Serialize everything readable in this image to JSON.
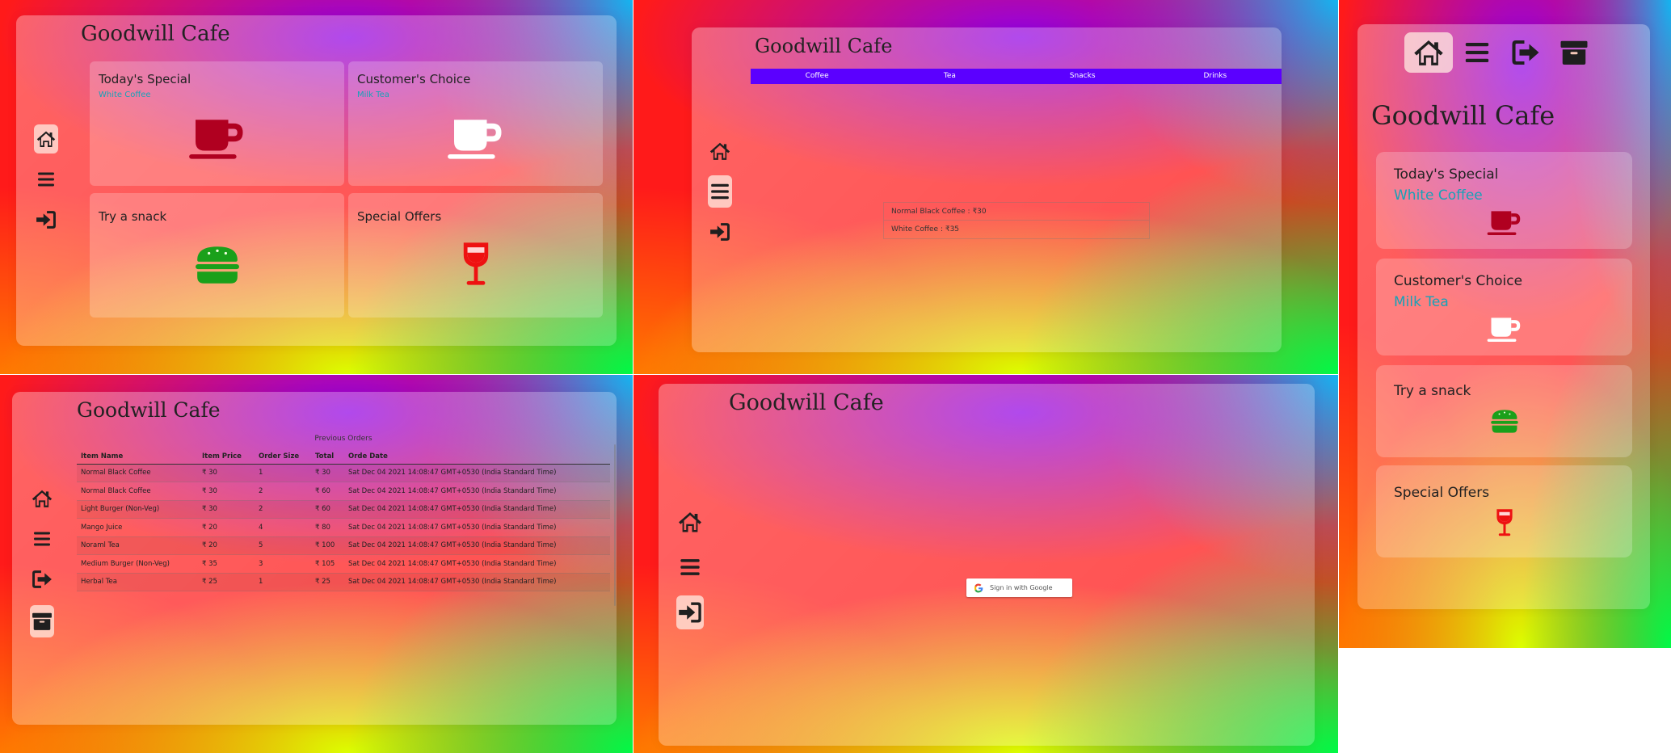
{
  "app_title": "Goodwill Cafe",
  "colors": {
    "menu_bar": "#5b00ff",
    "coffee_red": "#b00020",
    "snack_green": "#1aa01a",
    "drink_red": "#ee1111",
    "subtitle_teal": "#17a2b8"
  },
  "home": {
    "tiles": [
      {
        "title": "Today's Special",
        "subtitle": "White Coffee",
        "icon": "coffee-cup-icon"
      },
      {
        "title": "Customer's Choice",
        "subtitle": "Milk Tea",
        "icon": "coffee-cup-icon"
      },
      {
        "title": "Try a snack",
        "subtitle": "",
        "icon": "burger-icon"
      },
      {
        "title": "Special Offers",
        "subtitle": "",
        "icon": "wine-glass-icon"
      }
    ]
  },
  "menu": {
    "tabs": [
      "Coffee",
      "Tea",
      "Snacks",
      "Drinks"
    ],
    "items": [
      "Normal Black Coffee : ₹30",
      "White Coffee : ₹35"
    ]
  },
  "orders": {
    "caption": "Previous Orders",
    "headers": [
      "Item Name",
      "Item Price",
      "Order Size",
      "Total",
      "Orde Date"
    ],
    "rows": [
      [
        "Normal Black Coffee",
        "₹ 30",
        "1",
        "₹ 30",
        "Sat Dec 04 2021 14:08:47 GMT+0530 (India Standard Time)"
      ],
      [
        "Normal Black Coffee",
        "₹ 30",
        "2",
        "₹ 60",
        "Sat Dec 04 2021 14:08:47 GMT+0530 (India Standard Time)"
      ],
      [
        "Light Burger (Non-Veg)",
        "₹ 30",
        "2",
        "₹ 60",
        "Sat Dec 04 2021 14:08:47 GMT+0530 (India Standard Time)"
      ],
      [
        "Mango Juice",
        "₹ 20",
        "4",
        "₹ 80",
        "Sat Dec 04 2021 14:08:47 GMT+0530 (India Standard Time)"
      ],
      [
        "Noraml Tea",
        "₹ 20",
        "5",
        "₹ 100",
        "Sat Dec 04 2021 14:08:47 GMT+0530 (India Standard Time)"
      ],
      [
        "Medium Burger (Non-Veg)",
        "₹ 35",
        "3",
        "₹ 105",
        "Sat Dec 04 2021 14:08:47 GMT+0530 (India Standard Time)"
      ],
      [
        "Herbal Tea",
        "₹ 25",
        "1",
        "₹ 25",
        "Sat Dec 04 2021 14:08:47 GMT+0530 (India Standard Time)"
      ]
    ]
  },
  "login": {
    "google_button": "Sign in with Google"
  }
}
